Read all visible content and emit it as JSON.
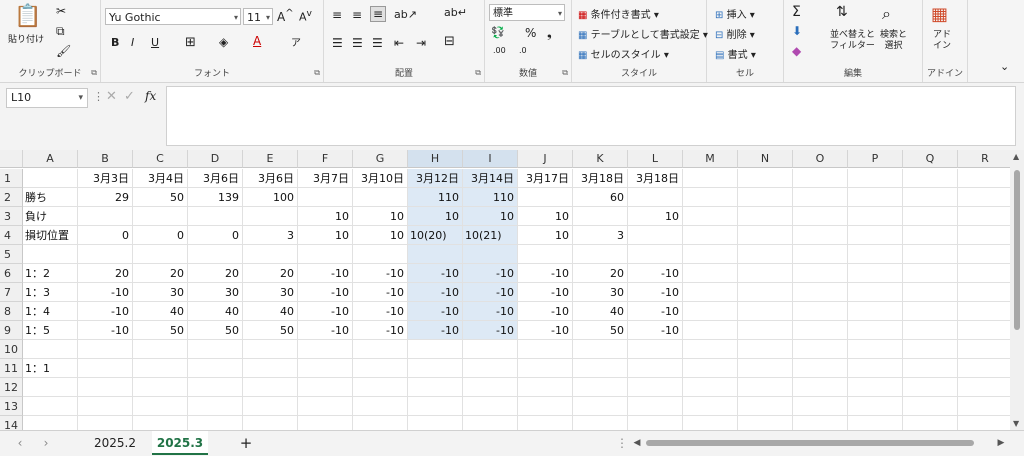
{
  "ribbon": {
    "clipboard": {
      "label": "クリップボード",
      "paste": "貼り付け"
    },
    "font": {
      "label": "フォント",
      "name": "Yu Gothic",
      "size": "11",
      "bold": "B",
      "italic": "I",
      "underline": "U"
    },
    "alignment": {
      "label": "配置"
    },
    "number": {
      "label": "数値",
      "format": "標準"
    },
    "styles": {
      "label": "スタイル",
      "conditional": "条件付き書式",
      "table": "テーブルとして書式設定",
      "cell_styles": "セルのスタイル"
    },
    "cells": {
      "label": "セル",
      "insert": "挿入",
      "delete": "削除",
      "format": "書式"
    },
    "editing": {
      "label": "編集",
      "sort": "並べ替えと",
      "sort2": "フィルター",
      "find": "検索と",
      "find2": "選択"
    },
    "addins": {
      "label": "アドイン",
      "btn": "アド",
      "btn2": "イン"
    }
  },
  "formula_bar": {
    "name_box": "L10",
    "fx": "fx"
  },
  "columns": [
    "A",
    "B",
    "C",
    "D",
    "E",
    "F",
    "G",
    "H",
    "I",
    "J",
    "K",
    "L",
    "M",
    "N",
    "O",
    "P",
    "Q",
    "R"
  ],
  "rows": [
    "1",
    "2",
    "3",
    "4",
    "5",
    "6",
    "7",
    "8",
    "9",
    "10",
    "11",
    "12",
    "13",
    "14"
  ],
  "cells": {
    "B1": "3月3日",
    "C1": "3月4日",
    "D1": "3月6日",
    "E1": "3月6日",
    "F1": "3月7日",
    "G1": "3月10日",
    "H1": "3月12日",
    "I1": "3月14日",
    "J1": "3月17日",
    "K1": "3月18日",
    "L1": "3月18日",
    "A2": "勝ち",
    "B2": "29",
    "C2": "50",
    "D2": "139",
    "E2": "100",
    "H2": "110",
    "I2": "110",
    "K2": "60",
    "A3": "負け",
    "F3": "10",
    "G3": "10",
    "H3": "10",
    "I3": "10",
    "J3": "10",
    "L3": "10",
    "A4": "損切位置",
    "B4": "0",
    "C4": "0",
    "D4": "0",
    "E4": "3",
    "F4": "10",
    "G4": "10",
    "H4": "10(20)",
    "I4": "10(21)",
    "J4": "10",
    "K4": "3",
    "A6": "1：2",
    "B6": "20",
    "C6": "20",
    "D6": "20",
    "E6": "20",
    "F6": "-10",
    "G6": "-10",
    "H6": "-10",
    "I6": "-10",
    "J6": "-10",
    "K6": "20",
    "L6": "-10",
    "A7": "1：3",
    "B7": "-10",
    "C7": "30",
    "D7": "30",
    "E7": "30",
    "F7": "-10",
    "G7": "-10",
    "H7": "-10",
    "I7": "-10",
    "J7": "-10",
    "K7": "30",
    "L7": "-10",
    "A8": "1：4",
    "B8": "-10",
    "C8": "40",
    "D8": "40",
    "E8": "40",
    "F8": "-10",
    "G8": "-10",
    "H8": "-10",
    "I8": "-10",
    "J8": "-10",
    "K8": "40",
    "L8": "-10",
    "A9": "1：5",
    "B9": "-10",
    "C9": "50",
    "D9": "50",
    "E9": "50",
    "F9": "-10",
    "G9": "-10",
    "H9": "-10",
    "I9": "-10",
    "J9": "-10",
    "K9": "50",
    "L9": "-10",
    "A11": "1：1"
  },
  "sheets": [
    {
      "name": "2025.2",
      "active": false
    },
    {
      "name": "2025.3",
      "active": true
    }
  ],
  "add_sheet": "+",
  "colors": {
    "selection": "#dde9f5",
    "accent": "#217346"
  }
}
